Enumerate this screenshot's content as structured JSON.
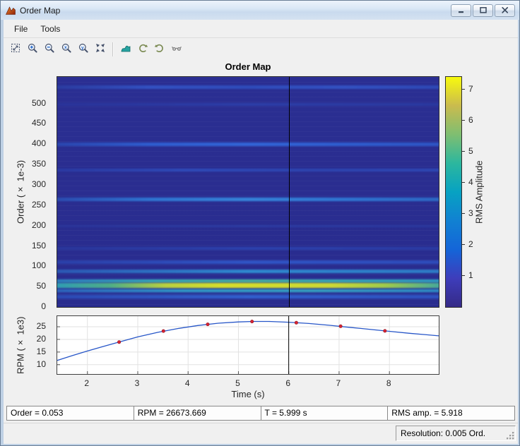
{
  "window": {
    "title": "Order Map",
    "menu_items": [
      "File",
      "Tools"
    ],
    "toolbar_icons": [
      "fit-to-window",
      "zoom-in",
      "zoom-out",
      "zoom-in-x",
      "zoom-in-y",
      "restore-view",
      "waterfall-view",
      "rotate-counterclockwise",
      "rotate-clockwise",
      "pan"
    ],
    "status_resolution": "Resolution: 0.005 Ord."
  },
  "readouts": {
    "order": "Order = 0.053",
    "rpm": "RPM = 26673.669",
    "time": "T = 5.999 s",
    "rms": "RMS amp. = 5.918"
  },
  "chart_data": [
    {
      "type": "heatmap",
      "title": "Order Map",
      "ylabel": "Order (× 1e-3)",
      "xlim": [
        1.4,
        8.98
      ],
      "ylim": [
        0,
        565
      ],
      "yticks": [
        0,
        50,
        100,
        150,
        200,
        250,
        300,
        350,
        400,
        450,
        500
      ],
      "cursor_time_s": 5.999,
      "cursor_order": 53,
      "cursor_rms": 5.918,
      "background_color": "#2a2e92",
      "colorbar": {
        "label": "RMS Amplitude",
        "ticks": [
          1,
          2,
          3,
          4,
          5,
          6,
          7
        ],
        "range": [
          0,
          7.4
        ],
        "colormap": "parula",
        "colors": [
          "#352a87",
          "#3e3dbb",
          "#1465d8",
          "#1181d2",
          "#07a2c2",
          "#2cb79e",
          "#7fbe71",
          "#cabb4e",
          "#f8fa0d"
        ]
      },
      "ridges": [
        {
          "order": 46,
          "width": 50,
          "colors": [
            "#3a63c422",
            "#3a63c42e",
            "#3a63c42e",
            "#3359b422"
          ]
        },
        {
          "order": 55,
          "width": 20,
          "colors": [
            "#2f8fc038",
            "#9fcc4438",
            "#9fcc4438",
            "#49a89938"
          ]
        },
        {
          "order": 540,
          "width": 9,
          "colors": [
            "#2b3ca0",
            "#3352c2",
            "#2f4cba",
            "#3352c2",
            "#2e48b4"
          ]
        },
        {
          "order": 497,
          "width": 7,
          "colors": [
            "#2a349a",
            "#2d3fa8",
            "#2b3aa0"
          ]
        },
        {
          "order": 400,
          "width": 9,
          "colors": [
            "#2b46ae",
            "#2f5ed0",
            "#3366d8",
            "#2f5ecf",
            "#2e55c4"
          ]
        },
        {
          "order": 336,
          "width": 8,
          "colors": [
            "#2a3aa2",
            "#2f4cba",
            "#2d45b0",
            "#2e48b4"
          ]
        },
        {
          "order": 265,
          "width": 9,
          "colors": [
            "#2b4cb0",
            "#2f76d2",
            "#3685da",
            "#2f76d2",
            "#2d68c4"
          ]
        },
        {
          "order": 198,
          "width": 6,
          "colors": [
            "#2a359a",
            "#2c3da4",
            "#2a389e"
          ]
        },
        {
          "order": 144,
          "width": 7,
          "colors": [
            "#2a379c",
            "#2c43ae",
            "#2b3ca4"
          ]
        },
        {
          "order": 110,
          "width": 8,
          "colors": [
            "#2b40a8",
            "#3056c6",
            "#2e4cba"
          ]
        },
        {
          "order": 88,
          "width": 8,
          "colors": [
            "#2c58b4",
            "#2f8cd0",
            "#2e7cc6"
          ]
        },
        {
          "order": 64,
          "width": 7,
          "colors": [
            "#2e7fbe",
            "#34a8ba",
            "#45b0a0",
            "#34a8ba",
            "#2f9bc2"
          ]
        },
        {
          "order": 53,
          "width": 11,
          "colors": [
            "#2f9cb4",
            "#4fae86",
            "#b9d13f",
            "#d6de2a",
            "#d2dc2e",
            "#cdd934",
            "#9fcb4b",
            "#44a89b"
          ]
        },
        {
          "order": 40,
          "width": 8,
          "colors": [
            "#2d65be",
            "#309cc6",
            "#36a4c0",
            "#2e8cc4"
          ]
        },
        {
          "order": 25,
          "width": 8,
          "colors": [
            "#2c4ab4",
            "#3260ce",
            "#2e52c0"
          ]
        }
      ]
    },
    {
      "type": "line",
      "xlabel": "Time (s)",
      "ylabel": "RPM (× 1e3)",
      "xlim": [
        1.4,
        8.98
      ],
      "ylim": [
        6.3,
        29.2
      ],
      "xticks": [
        2,
        3,
        4,
        5,
        6,
        7,
        8
      ],
      "yticks": [
        10,
        15,
        20,
        25
      ],
      "grid": true,
      "line_color": "#2756c8",
      "marker_color": "#d62333",
      "cursor_time_s": 5.999,
      "x": [
        1.4,
        1.7,
        2.0,
        2.3,
        2.6,
        3.0,
        3.4,
        3.8,
        4.2,
        4.6,
        5.0,
        5.3,
        5.6,
        6.0,
        6.4,
        6.8,
        7.2,
        7.6,
        8.0,
        8.4,
        8.7,
        8.98
      ],
      "y": [
        11.7,
        13.6,
        15.4,
        17.1,
        18.8,
        21.0,
        22.8,
        24.3,
        25.5,
        26.4,
        26.9,
        27.1,
        27.1,
        26.8,
        26.3,
        25.6,
        24.8,
        24.0,
        23.2,
        22.4,
        21.9,
        21.4
      ],
      "markers_x": [
        2.63,
        3.51,
        4.39,
        5.27,
        6.15,
        7.03,
        7.91
      ],
      "markers_y": [
        18.95,
        23.3,
        25.95,
        27.08,
        26.6,
        25.2,
        23.35
      ]
    }
  ]
}
